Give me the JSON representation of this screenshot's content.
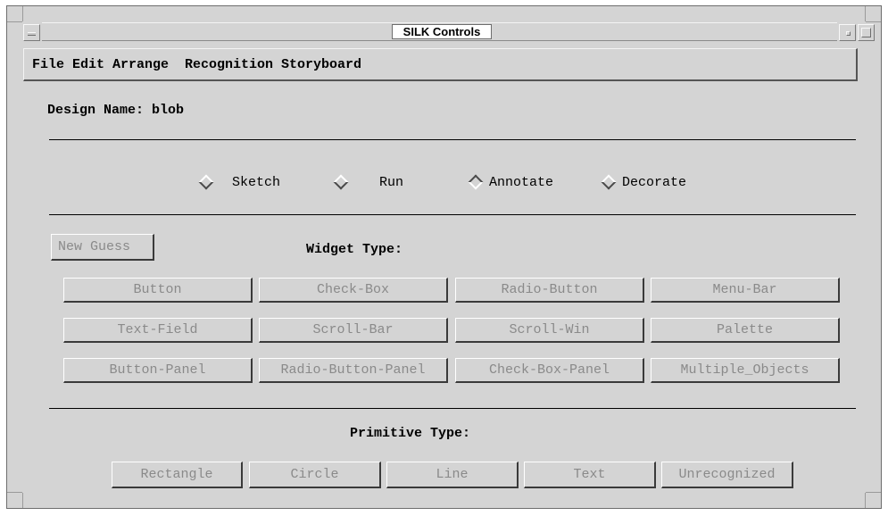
{
  "window": {
    "title": "SILK Controls"
  },
  "menubar": {
    "items": [
      "File",
      "Edit",
      "Arrange",
      "Recognition",
      "Storyboard"
    ]
  },
  "design": {
    "label": "Design Name: blob"
  },
  "modes": [
    {
      "label": "Sketch",
      "selected": false
    },
    {
      "label": "Run",
      "selected": false
    },
    {
      "label": "Annotate",
      "selected": true
    },
    {
      "label": "Decorate",
      "selected": false
    }
  ],
  "new_guess": {
    "label": "New Guess"
  },
  "widget_type": {
    "heading": "Widget Type:",
    "buttons": [
      "Button",
      "Check-Box",
      "Radio-Button",
      "Menu-Bar",
      "Text-Field",
      "Scroll-Bar",
      "Scroll-Win",
      "Palette",
      "Button-Panel",
      "Radio-Button-Panel",
      "Check-Box-Panel",
      "Multiple_Objects"
    ]
  },
  "primitive_type": {
    "heading": "Primitive Type:",
    "buttons": [
      "Rectangle",
      "Circle",
      "Line",
      "Text",
      "Unrecognized"
    ]
  },
  "colors": {
    "window_bg": "#d4d4d4",
    "disabled_text": "#8a8a8a"
  }
}
